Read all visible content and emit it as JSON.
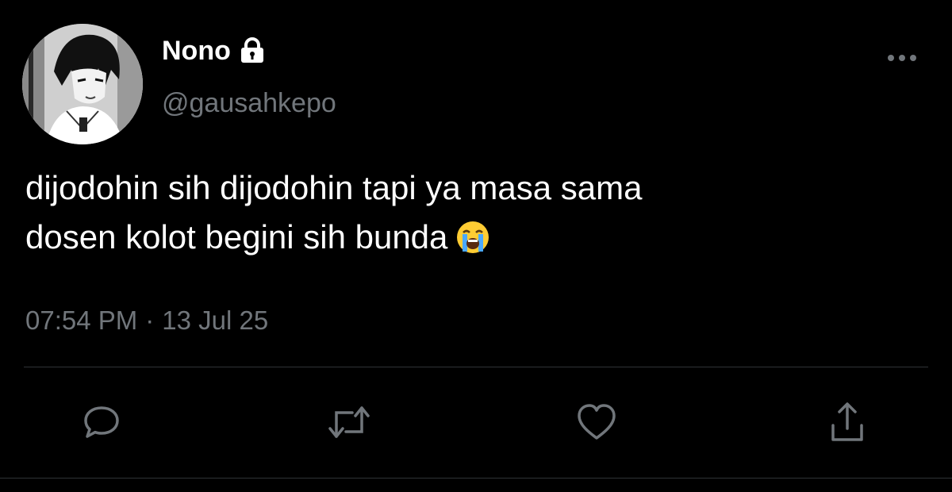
{
  "tweet": {
    "display_name": "Nono",
    "handle": "@gausahkepo",
    "text_lines": [
      "dijodohin sih dijodohin tapi ya masa sama",
      "dosen kolot begini sih bunda"
    ],
    "emoji": "loudly-crying-face-icon",
    "time": "07:54 PM",
    "separator": "·",
    "date": "13 Jul 25"
  },
  "icons": {
    "lock": "lock-icon",
    "more": "more-horizontal-icon",
    "reply": "reply-icon",
    "retweet": "retweet-icon",
    "like": "heart-icon",
    "share": "share-icon"
  },
  "colors": {
    "background": "#000000",
    "text_primary": "#ffffff",
    "text_secondary": "#71767b",
    "divider": "#2f3336",
    "action_icon": "#71767b"
  }
}
